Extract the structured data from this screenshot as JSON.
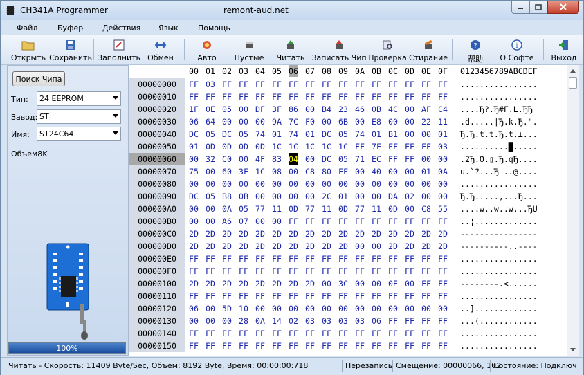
{
  "window": {
    "title": "CH341A Programmer",
    "center_title": "remont-aud.net"
  },
  "menu": [
    "Файл",
    "Буфер",
    "Действия",
    "Язык",
    "Помощь"
  ],
  "toolbar": {
    "open": "Открыть",
    "save": "Сохранить",
    "fill": "Заполнить",
    "swap": "Обмен",
    "auto": "Авто",
    "blank": "Пустые",
    "read": "Читать",
    "write": "Записать Чип",
    "verify": "Проверка",
    "erase": "Стирание",
    "help": "帮助",
    "about": "О Софте",
    "exit": "Выход"
  },
  "left": {
    "search_button": "Поиск Чипа",
    "type_label": "Тип:",
    "type_value": "24 EEPROM",
    "vendor_label": "Завод:",
    "vendor_value": "ST",
    "name_label": "Имя:",
    "name_value": "ST24C64",
    "size_text": "Объем8K",
    "progress_text": "100%",
    "progress_fraction": 1.0
  },
  "hex": {
    "columns": [
      "00",
      "01",
      "02",
      "03",
      "04",
      "05",
      "06",
      "07",
      "08",
      "09",
      "0A",
      "0B",
      "0C",
      "0D",
      "0E",
      "0F"
    ],
    "ascii_header": "0123456789ABCDEF",
    "selected_column": 6,
    "selected_row": 6,
    "cursor": {
      "row": 6,
      "col": 6
    },
    "rows": [
      {
        "addr": "00000000",
        "bytes": [
          "FF",
          "03",
          "FF",
          "FF",
          "FF",
          "FF",
          "FF",
          "FF",
          "FF",
          "FF",
          "FF",
          "FF",
          "FF",
          "FF",
          "FF",
          "FF"
        ],
        "ascii": "................"
      },
      {
        "addr": "00000010",
        "bytes": [
          "FF",
          "FF",
          "FF",
          "FF",
          "FF",
          "FF",
          "FF",
          "FF",
          "FF",
          "FF",
          "FF",
          "FF",
          "FF",
          "FF",
          "FF",
          "FF"
        ],
        "ascii": "................"
      },
      {
        "addr": "00000020",
        "bytes": [
          "1F",
          "0E",
          "05",
          "00",
          "DF",
          "3F",
          "86",
          "00",
          "B4",
          "23",
          "46",
          "0B",
          "4C",
          "00",
          "AF",
          "C4"
        ],
        "ascii": "....Ђ?.Ђ#F.L.ЂЂ"
      },
      {
        "addr": "00000030",
        "bytes": [
          "06",
          "64",
          "00",
          "00",
          "00",
          "9A",
          "7C",
          "F0",
          "00",
          "6B",
          "00",
          "E8",
          "00",
          "00",
          "22",
          "11"
        ],
        "ascii": ".d.....|Ђ.k.Ђ.\"."
      },
      {
        "addr": "00000040",
        "bytes": [
          "DC",
          "05",
          "DC",
          "05",
          "74",
          "01",
          "74",
          "01",
          "DC",
          "05",
          "74",
          "01",
          "B1",
          "00",
          "00",
          "01"
        ],
        "ascii": "Ђ.Ђ.t.t.Ђ.t.±..."
      },
      {
        "addr": "00000050",
        "bytes": [
          "01",
          "0D",
          "0D",
          "0D",
          "0D",
          "1C",
          "1C",
          "1C",
          "1C",
          "1C",
          "FF",
          "7F",
          "FF",
          "FF",
          "FF",
          "03"
        ],
        "ascii": "..........█....."
      },
      {
        "addr": "00000060",
        "bytes": [
          "00",
          "32",
          "C0",
          "00",
          "4F",
          "83",
          "04",
          "00",
          "DC",
          "05",
          "71",
          "EC",
          "FF",
          "FF",
          "00",
          "00"
        ],
        "ascii": ".2Ђ.O.▯.Ђ.qЂ...."
      },
      {
        "addr": "00000070",
        "bytes": [
          "75",
          "00",
          "60",
          "3F",
          "1C",
          "08",
          "00",
          "C8",
          "80",
          "FF",
          "00",
          "40",
          "00",
          "00",
          "01",
          "0A"
        ],
        "ascii": "u.`?...Ђ ..@...."
      },
      {
        "addr": "00000080",
        "bytes": [
          "00",
          "00",
          "00",
          "00",
          "00",
          "00",
          "00",
          "00",
          "00",
          "00",
          "00",
          "00",
          "00",
          "00",
          "00",
          "00"
        ],
        "ascii": "................"
      },
      {
        "addr": "00000090",
        "bytes": [
          "DC",
          "05",
          "B8",
          "0B",
          "00",
          "00",
          "00",
          "00",
          "2C",
          "01",
          "00",
          "00",
          "DA",
          "02",
          "00",
          "00"
        ],
        "ascii": "Ђ.Ђ.....,...Ђ..."
      },
      {
        "addr": "000000A0",
        "bytes": [
          "00",
          "00",
          "0A",
          "05",
          "77",
          "11",
          "0D",
          "77",
          "11",
          "0D",
          "77",
          "11",
          "0D",
          "00",
          "C8",
          "55"
        ],
        "ascii": "....w..w..w...ЂU"
      },
      {
        "addr": "000000B0",
        "bytes": [
          "00",
          "00",
          "A6",
          "07",
          "00",
          "00",
          "FF",
          "FF",
          "FF",
          "FF",
          "FF",
          "FF",
          "FF",
          "FF",
          "FF",
          "FF"
        ],
        "ascii": "..¦............."
      },
      {
        "addr": "000000C0",
        "bytes": [
          "2D",
          "2D",
          "2D",
          "2D",
          "2D",
          "2D",
          "2D",
          "2D",
          "2D",
          "2D",
          "2D",
          "2D",
          "2D",
          "2D",
          "2D",
          "2D"
        ],
        "ascii": "----------------"
      },
      {
        "addr": "000000D0",
        "bytes": [
          "2D",
          "2D",
          "2D",
          "2D",
          "2D",
          "2D",
          "2D",
          "2D",
          "2D",
          "2D",
          "00",
          "00",
          "2D",
          "2D",
          "2D",
          "2D"
        ],
        "ascii": "----------..----"
      },
      {
        "addr": "000000E0",
        "bytes": [
          "FF",
          "FF",
          "FF",
          "FF",
          "FF",
          "FF",
          "FF",
          "FF",
          "FF",
          "FF",
          "FF",
          "FF",
          "FF",
          "FF",
          "FF",
          "FF"
        ],
        "ascii": "................"
      },
      {
        "addr": "000000F0",
        "bytes": [
          "FF",
          "FF",
          "FF",
          "FF",
          "FF",
          "FF",
          "FF",
          "FF",
          "FF",
          "FF",
          "FF",
          "FF",
          "FF",
          "FF",
          "FF",
          "FF"
        ],
        "ascii": "................"
      },
      {
        "addr": "00000100",
        "bytes": [
          "2D",
          "2D",
          "2D",
          "2D",
          "2D",
          "2D",
          "2D",
          "2D",
          "00",
          "3C",
          "00",
          "00",
          "0E",
          "00",
          "FF",
          "FF"
        ],
        "ascii": "--------.<......"
      },
      {
        "addr": "00000110",
        "bytes": [
          "FF",
          "FF",
          "FF",
          "FF",
          "FF",
          "FF",
          "FF",
          "FF",
          "FF",
          "FF",
          "FF",
          "FF",
          "FF",
          "FF",
          "FF",
          "FF"
        ],
        "ascii": "................"
      },
      {
        "addr": "00000120",
        "bytes": [
          "06",
          "00",
          "5D",
          "10",
          "00",
          "00",
          "00",
          "00",
          "00",
          "00",
          "00",
          "00",
          "00",
          "00",
          "00",
          "00"
        ],
        "ascii": "..]............."
      },
      {
        "addr": "00000130",
        "bytes": [
          "00",
          "00",
          "00",
          "28",
          "0A",
          "14",
          "02",
          "03",
          "03",
          "03",
          "03",
          "06",
          "FF",
          "FF",
          "FF",
          "FF"
        ],
        "ascii": "...(............"
      },
      {
        "addr": "00000140",
        "bytes": [
          "FF",
          "FF",
          "FF",
          "FF",
          "FF",
          "FF",
          "FF",
          "FF",
          "FF",
          "FF",
          "FF",
          "FF",
          "FF",
          "FF",
          "FF",
          "FF"
        ],
        "ascii": "................"
      },
      {
        "addr": "00000150",
        "bytes": [
          "FF",
          "FF",
          "FF",
          "FF",
          "FF",
          "FF",
          "FF",
          "FF",
          "FF",
          "FF",
          "FF",
          "FF",
          "FF",
          "FF",
          "FF",
          "FF"
        ],
        "ascii": "................"
      }
    ]
  },
  "status": {
    "left": "Читать - Скорость: 11409 Byte/Sec, Объем: 8192 Byte, Время: 00:00:00:718",
    "mode": "Перезапись",
    "offset": "Смещение: 00000066, 102",
    "state": "Состояние: Подключен"
  },
  "colors": {
    "hex_text": "#1b26a8",
    "address_bg": "#d5dce6",
    "cursor_bg": "#000000",
    "cursor_fg": "#ffff00",
    "progress": "#1a4fa0"
  }
}
